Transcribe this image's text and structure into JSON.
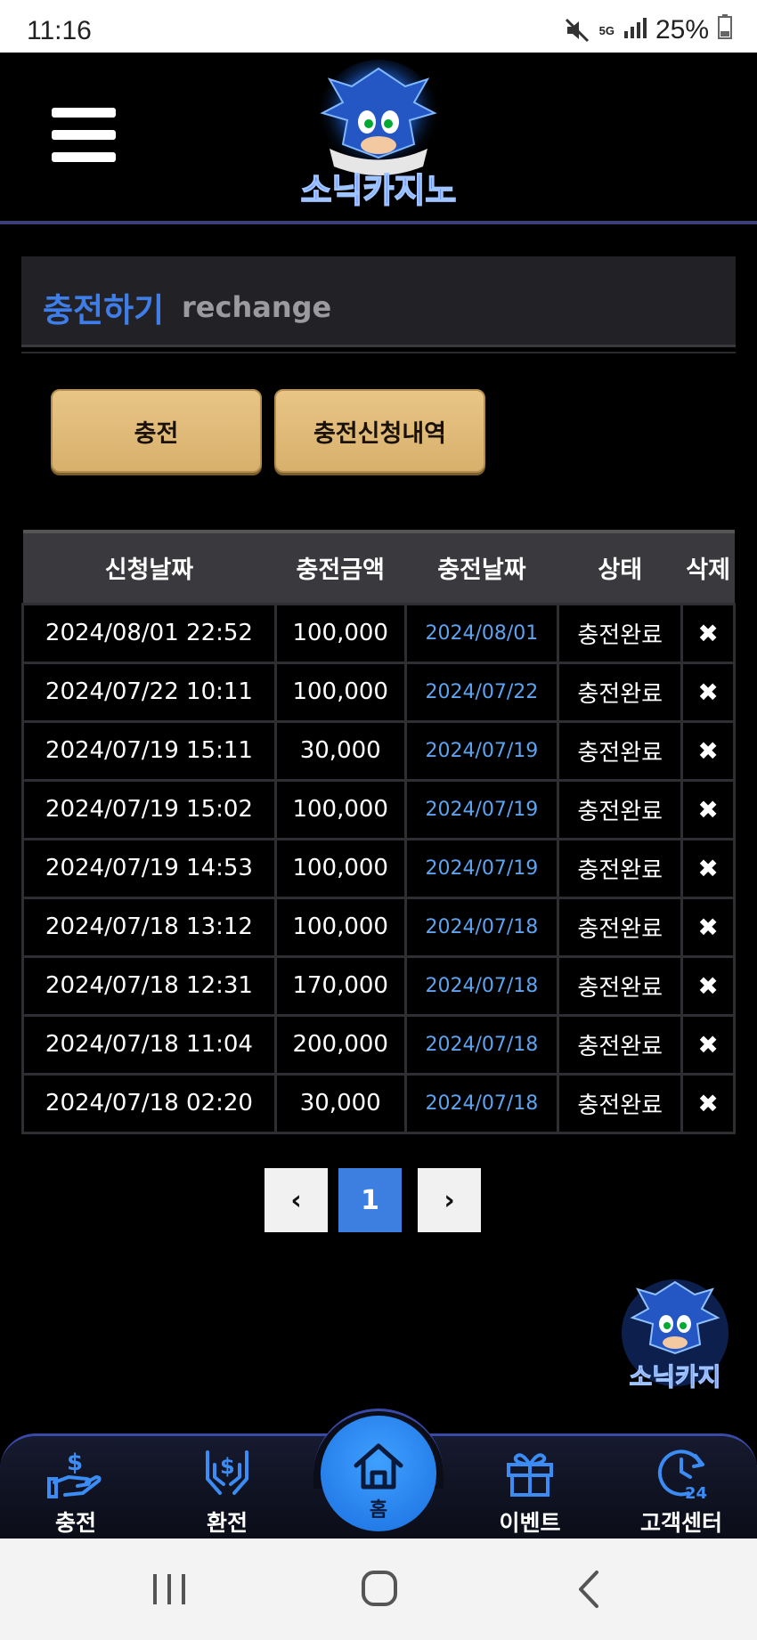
{
  "status_bar": {
    "time": "11:16",
    "network": "5G",
    "battery": "25%"
  },
  "header": {
    "logo_text": "소닉카지노"
  },
  "section": {
    "title": "충전하기",
    "subtitle": "rechange"
  },
  "buttons": {
    "charge": "충전",
    "history": "충전신청내역"
  },
  "table": {
    "headers": [
      "신청날짜",
      "충전금액",
      "충전날짜",
      "상태",
      "삭제"
    ],
    "rows": [
      {
        "request_date": "2024/08/01 22:52",
        "amount": "100,000",
        "charge_date": "2024/08/01",
        "status": "충전완료",
        "delete": "✖"
      },
      {
        "request_date": "2024/07/22 10:11",
        "amount": "100,000",
        "charge_date": "2024/07/22",
        "status": "충전완료",
        "delete": "✖"
      },
      {
        "request_date": "2024/07/19 15:11",
        "amount": "30,000",
        "charge_date": "2024/07/19",
        "status": "충전완료",
        "delete": "✖"
      },
      {
        "request_date": "2024/07/19 15:02",
        "amount": "100,000",
        "charge_date": "2024/07/19",
        "status": "충전완료",
        "delete": "✖"
      },
      {
        "request_date": "2024/07/19 14:53",
        "amount": "100,000",
        "charge_date": "2024/07/19",
        "status": "충전완료",
        "delete": "✖"
      },
      {
        "request_date": "2024/07/18 13:12",
        "amount": "100,000",
        "charge_date": "2024/07/18",
        "status": "충전완료",
        "delete": "✖"
      },
      {
        "request_date": "2024/07/18 12:31",
        "amount": "170,000",
        "charge_date": "2024/07/18",
        "status": "충전완료",
        "delete": "✖"
      },
      {
        "request_date": "2024/07/18 11:04",
        "amount": "200,000",
        "charge_date": "2024/07/18",
        "status": "충전완료",
        "delete": "✖"
      },
      {
        "request_date": "2024/07/18 02:20",
        "amount": "30,000",
        "charge_date": "2024/07/18",
        "status": "충전완료",
        "delete": "✖"
      }
    ]
  },
  "pagination": {
    "prev": "‹",
    "current": "1",
    "next": "›"
  },
  "float_badge": {
    "text": "소닉카지"
  },
  "bottom_nav": {
    "charge": "충전",
    "exchange": "환전",
    "home": "홈",
    "event": "이벤트",
    "support": "고객센터"
  },
  "colors": {
    "accent_blue": "#3f7ee8",
    "gold": "#e0bb79",
    "date_blue": "#5ea3ef"
  }
}
